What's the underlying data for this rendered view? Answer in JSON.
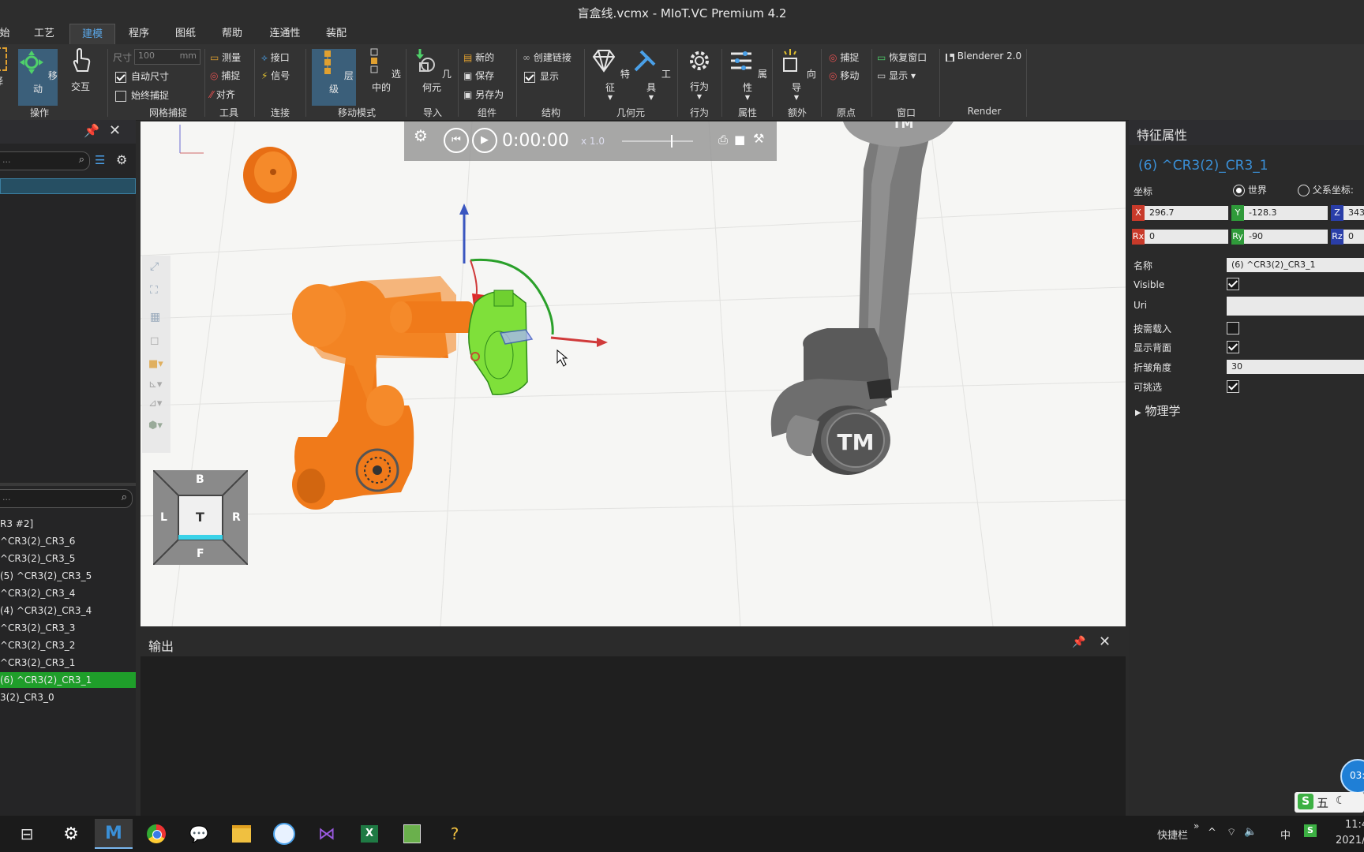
{
  "window": {
    "title": "盲盒线.vcmx - MIoT.VC Premium 4.2"
  },
  "menu": {
    "items": [
      "始",
      "工艺",
      "建模",
      "程序",
      "图纸",
      "帮助",
      "连通性",
      "装配"
    ],
    "active": "建模"
  },
  "ribbon": {
    "groups": {
      "ops": "操作",
      "grid": "网格捕捉",
      "tools": "工具",
      "connect": "连接",
      "move_mode": "移动模式",
      "import": "导入",
      "component": "组件",
      "structure": "结构",
      "geometry": "几何元",
      "behavior": "行为",
      "props": "属性",
      "extra": "额外",
      "origin": "原点",
      "window": "窗口",
      "render": "Render"
    },
    "ops": {
      "select": "择",
      "move": "移动",
      "interact": "交互"
    },
    "grid": {
      "size_label": "尺寸",
      "size_value": "100",
      "size_unit": "mm",
      "auto_size": "自动尺寸",
      "always_snap": "始终捕捉"
    },
    "tools": {
      "measure": "测量",
      "snap": "捕捉",
      "align": "对齐"
    },
    "connect": {
      "interface": "接口",
      "signal": "信号"
    },
    "move_mode": {
      "hierarchy": "层级",
      "selected": "选中的"
    },
    "import": {
      "geometry": "几何元"
    },
    "component": {
      "new": "新的",
      "save": "保存",
      "save_as": "另存为"
    },
    "structure": {
      "create_link": "创建链接",
      "show": "显示"
    },
    "geometry": {
      "feature": "特征",
      "tool": "工具"
    },
    "behavior": {
      "behavior": "行为"
    },
    "props": {
      "props": "属性"
    },
    "extra": {
      "wizard": "向导"
    },
    "origin": {
      "snap": "捕捉",
      "move": "移动"
    },
    "window": {
      "restore": "恢复窗口",
      "show": "显示 ▾"
    },
    "render": {
      "blenderer": "Blenderer 2.0"
    }
  },
  "left_panel": {
    "tree_items": [
      "R3 #2]",
      "^CR3(2)_CR3_6",
      "^CR3(2)_CR3_5",
      "(5) ^CR3(2)_CR3_5",
      "^CR3(2)_CR3_4",
      "(4) ^CR3(2)_CR3_4",
      "^CR3(2)_CR3_3",
      "^CR3(2)_CR3_2",
      "^CR3(2)_CR3_1",
      "(6) ^CR3(2)_CR3_1",
      "3(2)_CR3_0"
    ],
    "selected_index": 9,
    "search_placeholder": "..."
  },
  "sim_bar": {
    "time": "0:00:00",
    "speed": "x 1.0"
  },
  "navcube": {
    "top": "B",
    "left": "L",
    "center": "T",
    "right": "R",
    "bottom": "F"
  },
  "output": {
    "title": "输出"
  },
  "properties": {
    "panel_title": "特征属性",
    "feature_name": "(6) ^CR3(2)_CR3_1",
    "coord_label": "坐标",
    "world": "世界",
    "parent": "父系坐标:",
    "x": "296.7",
    "y": "-128.3",
    "z": "343",
    "rx": "0",
    "ry": "-90",
    "rz": "0",
    "name_label": "名称",
    "name_value": "(6) ^CR3(2)_CR3_1",
    "visible_label": "Visible",
    "uri_label": "Uri",
    "load_on_demand": "按需载入",
    "backface": "显示背面",
    "crease_label": "折皱角度",
    "crease_value": "30",
    "selectable": "可挑选",
    "physics": "物理学"
  },
  "taskbar": {
    "quicklaunch": "快捷栏",
    "ime": "中",
    "time": "11:4",
    "date": "2021/",
    "ime_badge": "五",
    "float_time": "03:"
  },
  "colors": {
    "accent": "#3a8fd6",
    "selected_green": "#1f9e2a",
    "robot_orange": "#f07a1a",
    "highlight_green": "#7fe03a"
  }
}
